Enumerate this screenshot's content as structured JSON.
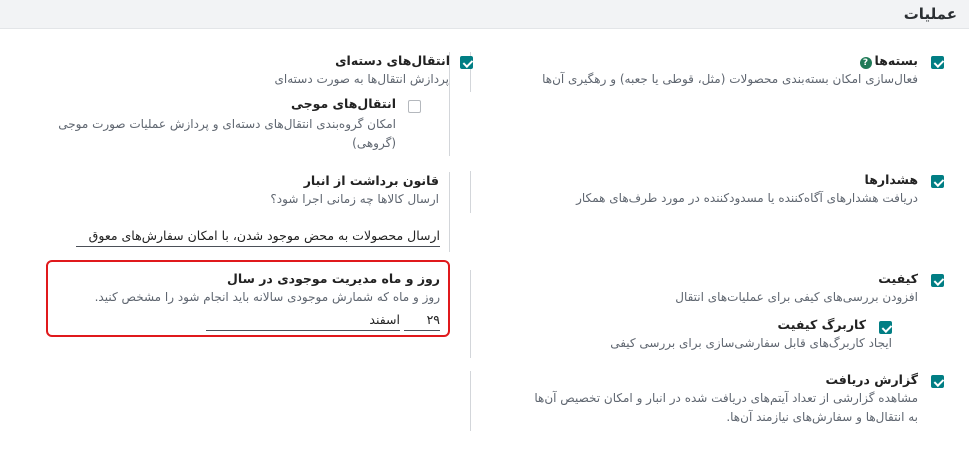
{
  "section": {
    "title": "عملیات"
  },
  "settings": {
    "packages": {
      "label": "بسته‌ها",
      "help": "?",
      "desc": "فعال‌سازی امکان بسته‌بندی محصولات (مثل، قوطی یا جعبه) و رهگیری آن‌ها",
      "checked": true
    },
    "batch": {
      "label": "انتقال‌های دسته‌ای",
      "desc": "پردازش انتقال‌ها به صورت دسته‌ای",
      "checked": true
    },
    "wave": {
      "label": "انتقال‌های موجی",
      "desc_line1": "امکان گروه‌بندی انتقال‌های دسته‌ای و پردازش عملیات صورت موجی",
      "desc_line2": "(گروهی)",
      "checked": false
    },
    "warnings": {
      "label": "هشدارها",
      "desc": "دریافت هشدارهای آگاه‌کننده یا مسدودکننده در مورد طرف‌های همکار",
      "checked": true
    },
    "removal": {
      "label": "قانون برداشت از انبار",
      "desc": "ارسال کالاها چه زمانی اجرا شود؟",
      "value": "ارسال محصولات به محض موجود شدن، با امکان سفارش‌های معوق"
    },
    "quality": {
      "label": "کیفیت",
      "desc": "افزودن بررسی‌های کیفی برای عملیات‌های انتقال",
      "checked": true
    },
    "quality_worksheet": {
      "label": "کاربرگ کیفیت",
      "desc": "ایجاد کاربرگ‌های قابل سفارشی‌سازی برای بررسی کیفی",
      "checked": true
    },
    "annual_inventory": {
      "label": "روز و ماه مدیریت موجودی در سال",
      "desc": "روز و ماه که شمارش موجودی سالانه باید انجام شود را مشخص کنید.",
      "day": "۲۹",
      "month": "اسفند"
    },
    "reception_report": {
      "label": "گزارش دریافت",
      "desc_line1": "مشاهده گزارشی از تعداد آیتم‌های دریافت شده در انبار و امکان تخصیص آن‌ها",
      "desc_line2": "به انتقال‌ها و سفارش‌های نیازمند آن‌ها.",
      "checked": true
    }
  }
}
